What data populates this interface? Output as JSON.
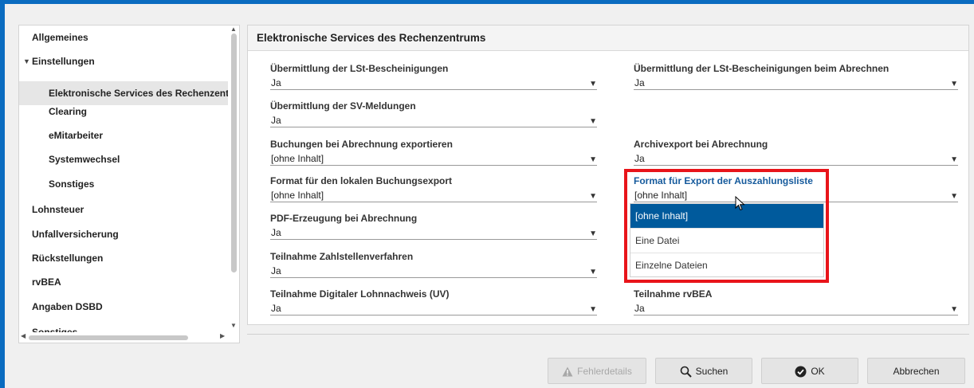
{
  "sidebar": {
    "items": [
      {
        "label": "Allgemeines"
      },
      {
        "label": "Einstellungen"
      },
      {
        "label": "Elektronische Services des Rechenzentrums"
      },
      {
        "label": "Clearing"
      },
      {
        "label": "eMitarbeiter"
      },
      {
        "label": "Systemwechsel"
      },
      {
        "label": "Sonstiges"
      },
      {
        "label": "Lohnsteuer"
      },
      {
        "label": "Unfallversicherung"
      },
      {
        "label": "Rückstellungen"
      },
      {
        "label": "rvBEA"
      },
      {
        "label": "Angaben DSBD"
      },
      {
        "label": "Sonstiges"
      }
    ]
  },
  "panel": {
    "title": "Elektronische Services des Rechenzentrums",
    "fields": [
      {
        "label": "Übermittlung der LSt-Bescheinigungen",
        "value": "Ja"
      },
      {
        "label": "Übermittlung der LSt-Bescheinigungen beim Abrechnen",
        "value": "Ja"
      },
      {
        "label": "Übermittlung der SV-Meldungen",
        "value": "Ja"
      },
      {
        "label": "Buchungen bei Abrechnung exportieren",
        "value": "[ohne Inhalt]"
      },
      {
        "label": "Archivexport bei Abrechnung",
        "value": "Ja"
      },
      {
        "label": "Format für den lokalen Buchungsexport",
        "value": "[ohne Inhalt]"
      },
      {
        "label": "Format für Export der Auszahlungsliste",
        "value": "[ohne Inhalt]"
      },
      {
        "label": "PDF-Erzeugung bei Abrechnung",
        "value": "Ja"
      },
      {
        "label": "Teilnahme Zahlstellenverfahren",
        "value": "Ja"
      },
      {
        "label": "Teilnahme Digitaler Lohnnachweis (UV)",
        "value": "Ja"
      },
      {
        "label": "Teilnahme rvBEA",
        "value": "Ja"
      }
    ],
    "dropdown": {
      "options": [
        "[ohne Inhalt]",
        "Eine Datei",
        "Einzelne Dateien"
      ],
      "selected_index": 0
    }
  },
  "buttons": {
    "fehlerdetails": "Fehlerdetails",
    "suchen": "Suchen",
    "ok": "OK",
    "abbrechen": "Abbrechen"
  },
  "colors": {
    "accent": "#0a6cc0",
    "selected": "#005a9c",
    "highlight": "#e8141a"
  }
}
